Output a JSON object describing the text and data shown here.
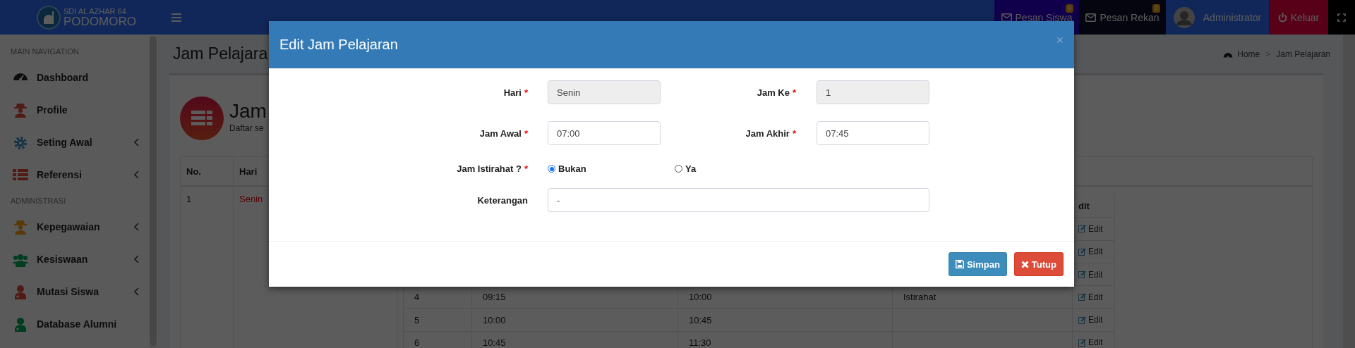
{
  "header": {
    "logo_line1": "SDI AL AZHAR 64",
    "logo_line2": "PODOMORO",
    "nav": [
      {
        "kind": "message",
        "label": "Pesan Siswa",
        "badge": "0"
      },
      {
        "kind": "message",
        "label": "Pesan Rekan",
        "badge": "0"
      },
      {
        "kind": "user",
        "label": "Administrator"
      },
      {
        "kind": "logout",
        "label": "Keluar"
      },
      {
        "kind": "fullscreen"
      }
    ]
  },
  "sidebar": {
    "sections": [
      {
        "title": "MAIN NAVIGATION",
        "items": [
          {
            "label": "Dashboard",
            "has_submenu": false
          },
          {
            "label": "Profile",
            "has_submenu": false
          },
          {
            "label": "Seting Awal",
            "has_submenu": true
          },
          {
            "label": "Referensi",
            "has_submenu": true
          }
        ]
      },
      {
        "title": "ADMINISTRASI",
        "items": [
          {
            "label": "Kepegawaian",
            "has_submenu": true
          },
          {
            "label": "Kesiswaan",
            "has_submenu": true
          },
          {
            "label": "Mutasi Siswa",
            "has_submenu": true
          },
          {
            "label": "Database Alumni",
            "has_submenu": false
          }
        ]
      }
    ]
  },
  "content": {
    "title": "Jam Pelajara",
    "breadcrumb": {
      "items": [
        "Home",
        "Jam Pelajaran"
      ],
      "separator": ">"
    },
    "box_title": "Jam",
    "box_subtitle": "Daftar se",
    "table": {
      "columns": [
        "No.",
        "Hari"
      ],
      "rows": [
        {
          "no": "1",
          "hari": "Senin"
        }
      ],
      "detail": {
        "column_5": "dit",
        "rows": [
          {
            "edit": "Edit"
          },
          {
            "edit": "Edit"
          },
          {
            "edit": "Edit"
          },
          {
            "no": "4",
            "jam_awal": "09:15",
            "jam_akhir": "10:00",
            "keterangan": "Istirahat",
            "edit": "Edit"
          },
          {
            "no": "5",
            "jam_awal": "10:00",
            "jam_akhir": "10:45",
            "edit": "Edit"
          },
          {
            "no": "6",
            "jam_awal": "10:45",
            "jam_akhir": "11:30",
            "edit": "Edit"
          }
        ]
      }
    }
  },
  "modal": {
    "title": "Edit Jam Pelajaran",
    "close": "×",
    "fields": [
      {
        "label": "Hari",
        "mark": "*",
        "value": "Senin",
        "disabled": true
      },
      {
        "label": "Jam Ke",
        "mark": "*",
        "value": "1",
        "disabled": true
      },
      {
        "label": "Jam Awal",
        "mark": "*",
        "value": "07:00",
        "disabled": false
      },
      {
        "label": "Jam Akhir",
        "mark": "*",
        "value": "07:45",
        "disabled": false
      }
    ],
    "radio": {
      "label": "Jam Istirahat ?",
      "mark": "*",
      "options": [
        {
          "label": "Bukan",
          "selected": true
        },
        {
          "label": "Ya",
          "selected": false
        }
      ]
    },
    "notes": {
      "label": "Keterangan",
      "value": "-"
    },
    "buttons": [
      {
        "kind": "save",
        "label": "Simpan"
      },
      {
        "kind": "close",
        "label": "Tutup"
      }
    ]
  }
}
